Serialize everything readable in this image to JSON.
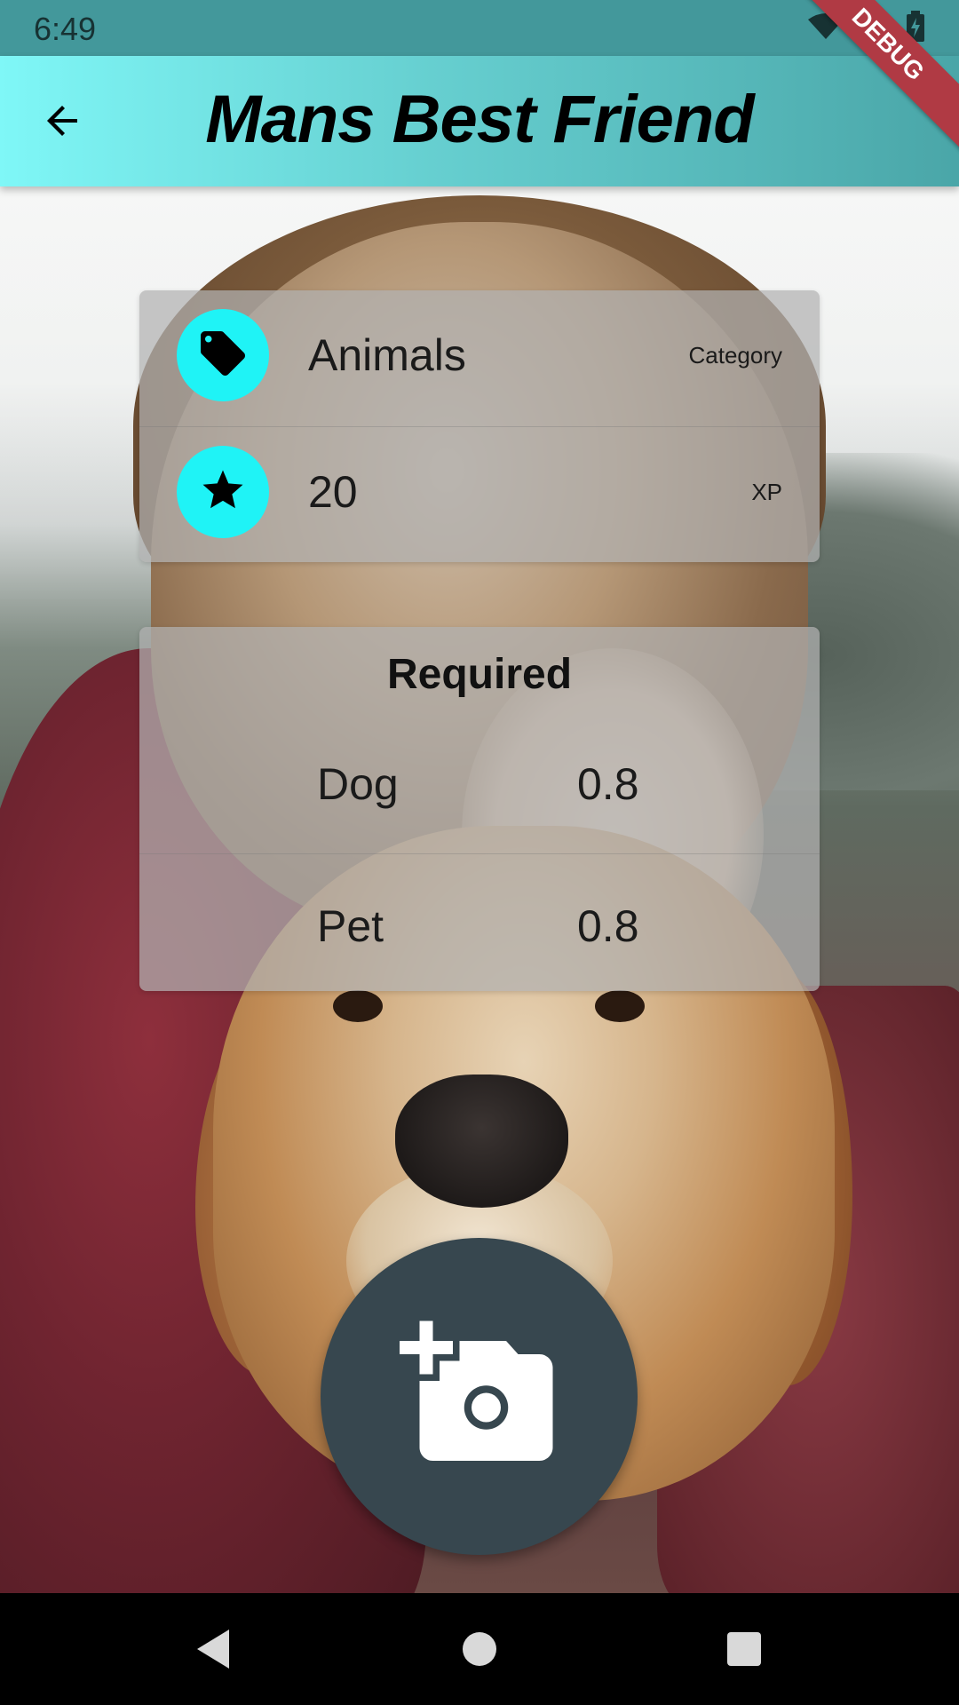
{
  "status_bar": {
    "time": "6:49"
  },
  "app_bar": {
    "title": "Mans Best Friend"
  },
  "debug_banner": "DEBUG",
  "info_card": {
    "rows": [
      {
        "icon": "tag-icon",
        "value": "Animals",
        "label": "Category"
      },
      {
        "icon": "star-icon",
        "value": "20",
        "label": "XP"
      }
    ]
  },
  "required_card": {
    "title": "Required",
    "items": [
      {
        "name": "Dog",
        "value": "0.8"
      },
      {
        "name": "Pet",
        "value": "0.8"
      }
    ]
  },
  "fab": {
    "icon": "add-photo-icon"
  },
  "colors": {
    "app_bar_start": "#7ff7f7",
    "app_bar_end": "#4aa6a8",
    "icon_circle": "#1ff3f6",
    "fab": "#37474f"
  }
}
